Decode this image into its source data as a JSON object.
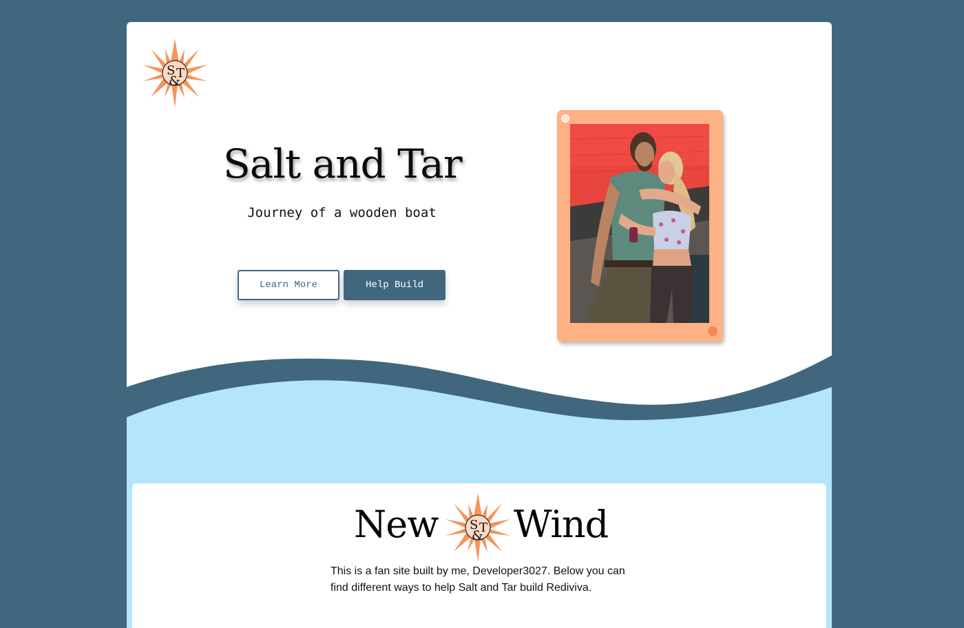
{
  "colors": {
    "background": "#41677f",
    "accent": "#ffb186",
    "sun": "#f5955a",
    "light_blue": "#b4e5fd",
    "card": "#ffffff"
  },
  "logo": {
    "monogram_top": "S",
    "monogram_amp": "&",
    "monogram_right": "T",
    "icon": "sun-compass-logo"
  },
  "hero": {
    "title": "Salt and Tar",
    "subtitle": "Journey of a wooden boat",
    "buttons": {
      "learn_more": "Learn More",
      "help_build": "Help Build"
    }
  },
  "photo": {
    "icon": "couple-photo"
  },
  "section": {
    "title_left": "New",
    "title_right": "Wind",
    "intro": "This is a fan site built by me, Developer3027. Below you can find different ways to help Salt and Tar build Rediviva."
  }
}
